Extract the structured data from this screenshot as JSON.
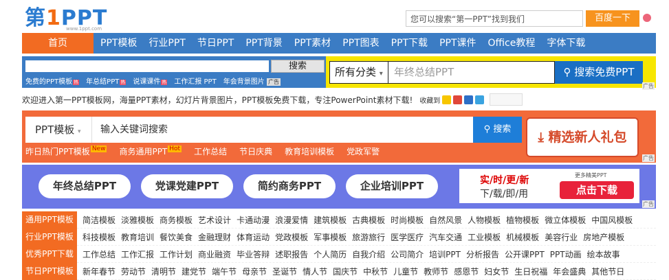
{
  "logo": {
    "main_a": "第",
    "main_one": "1",
    "main_b": "PPT",
    "sub": "www.1ppt.com"
  },
  "top_search": {
    "placeholder": "您可以搜索“第一PPT”找到我们",
    "button": "百度一下"
  },
  "nav": {
    "home": "首页",
    "items": [
      "PPT模板",
      "行业PPT",
      "节日PPT",
      "PPT背景",
      "PPT素材",
      "PPT图表",
      "PPT下载",
      "PPT课件",
      "Office教程",
      "字体下载"
    ]
  },
  "ad1": {
    "search_button": "搜索",
    "links": [
      "免费的PPT模板",
      "年总结PPT",
      "说课课件",
      "工作汇报 PPT",
      "年会背景图片"
    ],
    "hot_badge": "热",
    "close": "广告",
    "select": "所有分类",
    "keyword_placeholder": "年终总结PPT",
    "search_free_button": "搜索免费PPT",
    "ad_tag": "广告"
  },
  "welcome": {
    "text": "欢迎进入第一PPT模板网，海量PPT素材，幻灯片背景图片，PPT模板免费下载，专注PowerPoint素材下载!",
    "favorite": "收藏到"
  },
  "orange_search": {
    "select": "PPT模板",
    "placeholder": "输入关键词搜索",
    "button": "搜索",
    "gift": "精选新人礼包",
    "links": [
      "昨日热门PPT模板",
      "商务通用PPT",
      "工作总结",
      "节日庆典",
      "教育培训模板",
      "党政军警"
    ],
    "tag_new": "New",
    "tag_hot": "Hot",
    "ad_tag": "广告"
  },
  "promo": {
    "pills": [
      "年终总结PPT",
      "党课党建PPT",
      "简约商务PPT",
      "企业培训PPT"
    ],
    "right_line1": "实/时/更/新",
    "right_line2": "下/载/即/用",
    "more": "更多精美PPT",
    "download": "点击下载",
    "ad_tag": "广告"
  },
  "categories": [
    {
      "head": "通用PPT模板",
      "items": [
        "简洁模板",
        "淡雅模板",
        "商务模板",
        "艺术设计",
        "卡通动漫",
        "浪漫爱情",
        "建筑模板",
        "古典模板",
        "时尚模板",
        "自然风景",
        "人物模板",
        "植物模板",
        "微立体模板",
        "中国风模板"
      ]
    },
    {
      "head": "行业PPT模板",
      "items": [
        "科技模板",
        "教育培训",
        "餐饮美食",
        "金融理财",
        "体育运动",
        "党政模板",
        "军事模板",
        "旅游旅行",
        "医学医疗",
        "汽车交通",
        "工业模板",
        "机械模板",
        "美容行业",
        "房地产模板"
      ]
    },
    {
      "head": "优秀PPT下载",
      "items": [
        "工作总结",
        "工作汇报",
        "工作计划",
        "商业融资",
        "毕业答辩",
        "述职报告",
        "个人简历",
        "自我介绍",
        "公司简介",
        "培训PPT",
        "分析报告",
        "公开课PPT",
        "PPT动画",
        "绘本故事"
      ]
    },
    {
      "head": "节日PPT模板",
      "items": [
        "新年春节",
        "劳动节",
        "清明节",
        "建党节",
        "端午节",
        "母亲节",
        "圣诞节",
        "情人节",
        "国庆节",
        "中秋节",
        "儿童节",
        "教师节",
        "感恩节",
        "妇女节",
        "生日祝福",
        "年会盛典",
        "其他节日"
      ]
    }
  ]
}
